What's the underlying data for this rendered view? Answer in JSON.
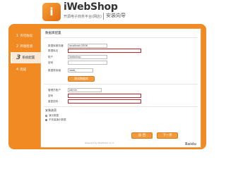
{
  "header": {
    "logo_letter": "i",
    "brand": "iWebShop",
    "subtitle": "开源电子商务平台(网店)",
    "wizard": "安装向导"
  },
  "steps": [
    {
      "num": "1",
      "label": "许可协议"
    },
    {
      "num": "2",
      "label": "环境检测"
    },
    {
      "num": "3",
      "label": "系统配置"
    },
    {
      "num": "4",
      "label": "完成"
    }
  ],
  "section_title": "数据库配置",
  "db_form": {
    "host": {
      "label": "数据库服务器",
      "value": "localhost:3306"
    },
    "name": {
      "label": "数据库名",
      "value": ""
    },
    "user": {
      "label": "账户",
      "value": "iwebshop"
    },
    "pass": {
      "label": "密码",
      "value": ""
    },
    "prefix": {
      "label": "数据表前缀",
      "value": "iweb_"
    },
    "test_button": "测试数据库"
  },
  "admin_form": {
    "name": {
      "label": "管理员账户",
      "value": "admin"
    },
    "pass": {
      "label": "密码",
      "value": ""
    },
    "repass": {
      "label": "重复密码",
      "value": ""
    }
  },
  "options": {
    "title": "安装选项",
    "items": [
      {
        "label": "演示数据",
        "selected": false
      },
      {
        "label": "不安装演示数据",
        "selected": true
      }
    ]
  },
  "buttons": {
    "prev": "返 回",
    "next": "下一步"
  },
  "footer": "Powered by iWebShop v2.4",
  "watermark": "Baidu"
}
